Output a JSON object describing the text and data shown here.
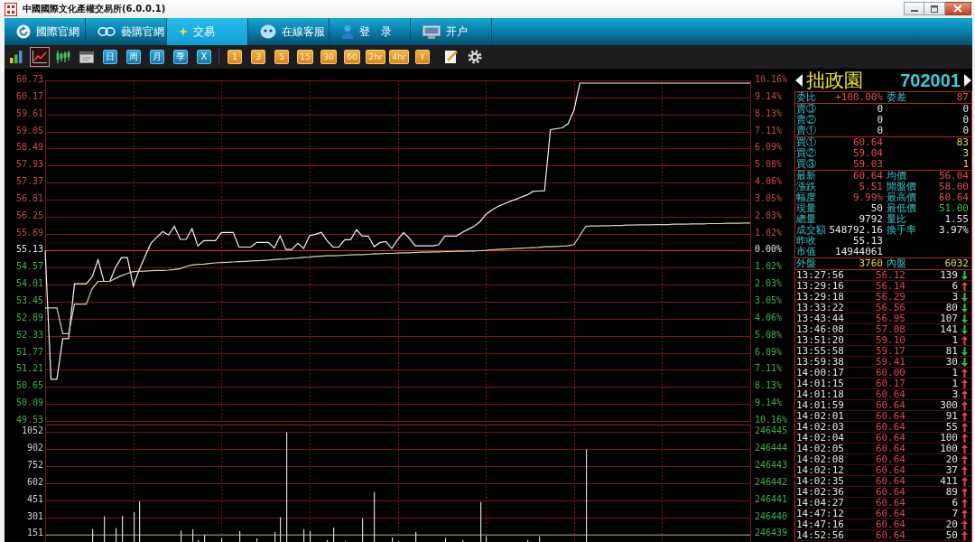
{
  "window": {
    "title": "中國國際文化產權交易所(6.0.0.1)"
  },
  "nav_tabs": [
    {
      "label": "國際官網",
      "selected": false
    },
    {
      "label": "藝購官網",
      "selected": false
    },
    {
      "label": "交易",
      "selected": true
    },
    {
      "label": "在線客服",
      "selected": false
    },
    {
      "label": "登　录",
      "selected": false
    },
    {
      "label": "开户",
      "selected": false
    }
  ],
  "toolbar": {
    "chart_modes": [
      {
        "selected": false
      },
      {
        "selected": true
      },
      {
        "selected": false
      },
      {
        "selected": false
      }
    ],
    "periods": [
      {
        "label": "日"
      },
      {
        "label": "周"
      },
      {
        "label": "月"
      },
      {
        "label": "季"
      },
      {
        "label": "X"
      }
    ],
    "intervals": [
      {
        "label": "1"
      },
      {
        "label": "3"
      },
      {
        "label": "5"
      },
      {
        "label": "15"
      },
      {
        "label": "30"
      },
      {
        "label": "60"
      },
      {
        "label": "2hr"
      },
      {
        "label": "4hr"
      },
      {
        "label": "Y"
      }
    ]
  },
  "price_chart": {
    "chart_data": {
      "type": "line",
      "grid": true,
      "ylim": [
        49.53,
        60.73
      ],
      "yticks": [
        {
          "value": 60.73,
          "label": "60.73"
        },
        {
          "value": 60.17,
          "label": "60.17"
        },
        {
          "value": 59.61,
          "label": "59.61"
        },
        {
          "value": 59.05,
          "label": "59.05"
        },
        {
          "value": 58.49,
          "label": "58.49"
        },
        {
          "value": 57.93,
          "label": "57.93"
        },
        {
          "value": 57.37,
          "label": "57.37"
        },
        {
          "value": 56.81,
          "label": "56.81"
        },
        {
          "value": 56.25,
          "label": "56.25"
        },
        {
          "value": 55.69,
          "label": "55.69"
        },
        {
          "value": 55.13,
          "label": "55.13"
        },
        {
          "value": 54.57,
          "label": "54.57"
        },
        {
          "value": 54.01,
          "label": "54.01"
        },
        {
          "value": 53.45,
          "label": "53.45"
        },
        {
          "value": 52.89,
          "label": "52.89"
        },
        {
          "value": 52.33,
          "label": "52.33"
        },
        {
          "value": 51.77,
          "label": "51.77"
        },
        {
          "value": 51.21,
          "label": "51.21"
        },
        {
          "value": 50.65,
          "label": "50.65"
        },
        {
          "value": 50.09,
          "label": "50.09"
        },
        {
          "value": 49.53,
          "label": "49.53"
        }
      ],
      "ref_lines": [
        {
          "axis": "y",
          "value": 55.13,
          "color": "#e03030"
        }
      ],
      "categories": [
        null,
        null,
        null,
        null,
        null,
        null,
        null,
        null,
        null,
        null,
        null,
        null,
        null,
        null,
        null,
        null,
        null,
        null,
        null,
        null,
        null,
        null,
        null,
        null,
        null,
        null,
        null,
        null,
        null,
        null,
        null,
        null,
        null,
        null,
        null,
        null,
        null,
        null,
        null,
        null,
        null,
        null,
        null,
        null,
        null,
        null,
        null,
        null,
        null,
        null,
        null,
        null,
        null,
        null,
        null,
        null,
        null,
        null,
        null,
        null,
        null,
        null,
        null,
        null,
        null,
        null,
        null,
        null,
        null,
        null,
        null,
        null,
        null,
        null,
        null,
        null,
        null,
        null,
        null,
        null,
        null,
        null,
        null,
        null,
        null,
        null,
        null,
        null,
        null,
        null,
        null,
        null,
        null,
        null,
        null,
        null,
        null,
        null,
        null,
        null,
        null,
        null,
        null,
        null,
        null,
        null,
        null,
        null,
        null,
        null,
        null,
        null,
        null,
        null,
        null,
        null,
        null,
        null,
        null,
        null,
        null
      ],
      "series": [
        {
          "color": "#f4f4f4",
          "values": [
            55.13,
            50.9,
            50.9,
            52.24,
            52.24,
            54.04,
            54.04,
            54.04,
            54.27,
            54.83,
            54.12,
            54.12,
            54.59,
            54.9,
            54.9,
            53.97,
            54.5,
            54.94,
            55.37,
            55.57,
            55.76,
            55.64,
            55.93,
            55.5,
            55.5,
            55.85,
            55.29,
            55.46,
            55.46,
            55.46,
            55.73,
            55.73,
            55.73,
            55.25,
            55.25,
            55.25,
            55.4,
            55.4,
            55.4,
            55.22,
            55.61,
            55.17,
            55.17,
            55.37,
            55.2,
            55.62,
            55.67,
            55.73,
            55.45,
            55.25,
            55.25,
            55.49,
            55.49,
            55.82,
            55.61,
            55.61,
            55.26,
            55.4,
            55.43,
            55.2,
            55.49,
            55.73,
            55.53,
            55.29,
            55.29,
            55.29,
            55.29,
            55.33,
            55.61,
            55.61,
            55.61,
            55.73,
            55.83,
            55.93,
            56.08,
            56.32,
            56.46,
            56.58,
            56.66,
            56.74,
            56.81,
            56.89,
            56.96,
            57.08,
            57.09,
            57.1,
            59.11,
            59.14,
            59.17,
            59.3,
            59.75,
            60.64,
            60.64,
            60.64,
            60.64,
            60.64,
            60.64,
            60.64,
            60.64,
            60.64,
            60.64,
            60.64,
            60.64,
            60.64,
            60.64,
            60.64,
            60.64,
            60.64,
            60.64,
            60.64,
            60.64,
            60.64,
            60.64,
            60.64,
            60.64,
            60.64,
            60.64,
            60.64,
            60.64,
            60.64,
            60.64
          ]
        },
        {
          "color": "#d6d6b4",
          "values": [
            53.25,
            53.25,
            53.25,
            52.4,
            52.4,
            53.37,
            53.37,
            53.37,
            53.88,
            54.12,
            54.12,
            54.12,
            54.22,
            54.31,
            54.38,
            54.44,
            54.45,
            54.46,
            54.47,
            54.48,
            54.48,
            54.49,
            54.51,
            54.54,
            54.61,
            54.66,
            54.68,
            54.69,
            54.71,
            54.73,
            54.74,
            54.75,
            54.76,
            54.77,
            54.78,
            54.79,
            54.8,
            54.81,
            54.82,
            54.84,
            54.85,
            54.86,
            54.88,
            54.89,
            54.91,
            54.92,
            54.94,
            54.95,
            54.96,
            54.96,
            54.97,
            54.98,
            54.99,
            55.0,
            55.0,
            55.01,
            55.02,
            55.03,
            55.04,
            55.04,
            55.05,
            55.06,
            55.06,
            55.07,
            55.08,
            55.08,
            55.09,
            55.09,
            55.1,
            55.1,
            55.11,
            55.11,
            55.12,
            55.12,
            55.13,
            55.14,
            55.16,
            55.17,
            55.18,
            55.19,
            55.2,
            55.21,
            55.22,
            55.23,
            55.24,
            55.26,
            55.26,
            55.27,
            55.28,
            55.29,
            55.33,
            55.63,
            55.93,
            55.94,
            55.94,
            55.95,
            55.95,
            55.96,
            55.96,
            55.97,
            55.97,
            55.98,
            55.98,
            55.98,
            55.99,
            55.99,
            55.99,
            56.0,
            56.0,
            56.0,
            56.01,
            56.01,
            56.01,
            56.02,
            56.02,
            56.02,
            56.03,
            56.03,
            56.03,
            56.04,
            56.04
          ]
        }
      ]
    },
    "right_axis_labels": [
      "10.16%",
      "9.14%",
      "8.13%",
      "7.11%",
      "6.09%",
      "5.08%",
      "4.06%",
      "3.05%",
      "2.03%",
      "1.02%",
      "0.00%",
      "1.02%",
      "2.03%",
      "3.05%",
      "4.06%",
      "5.08%",
      "6.09%",
      "7.11%",
      "8.13%",
      "9.14%",
      "10.16%"
    ]
  },
  "volume_chart": {
    "chart_data": {
      "type": "bar",
      "grid": true,
      "ylim": [
        83,
        1052
      ],
      "yticks": [
        {
          "value": 1052,
          "label": "1052"
        },
        {
          "value": 902,
          "label": "902"
        },
        {
          "value": 752,
          "label": "752"
        },
        {
          "value": 602,
          "label": "602"
        },
        {
          "value": 451,
          "label": "451"
        },
        {
          "value": 301,
          "label": "301"
        },
        {
          "value": 151,
          "label": "151"
        }
      ],
      "ref_lines": [
        {
          "axis": "y",
          "value": 147,
          "color": "#2ea84a"
        }
      ],
      "categories": [
        null,
        null,
        null,
        null,
        null,
        null,
        null,
        null,
        null,
        null,
        null,
        null,
        null,
        null,
        null,
        null,
        null,
        null,
        null,
        null,
        null,
        null,
        null,
        null,
        null,
        null,
        null,
        null,
        null,
        null,
        null,
        null,
        null,
        null,
        null,
        null,
        null,
        null,
        null,
        null,
        null,
        null,
        null,
        null,
        null,
        null,
        null,
        null,
        null,
        null,
        null,
        null,
        null,
        null,
        null,
        null,
        null,
        null,
        null,
        null,
        null,
        null,
        null,
        null,
        null,
        null,
        null,
        null,
        null,
        null,
        null,
        null,
        null,
        null,
        null,
        null,
        null,
        null,
        null,
        null,
        null,
        null,
        null,
        null,
        null,
        null,
        null,
        null,
        null,
        null,
        null,
        null,
        null,
        null,
        null,
        null,
        null,
        null,
        null,
        null,
        null,
        null,
        null,
        null,
        null,
        null,
        null,
        null,
        null,
        null,
        null,
        null,
        null,
        null,
        null,
        null,
        null,
        null,
        null,
        null,
        null
      ],
      "values": [
        null,
        null,
        null,
        null,
        null,
        null,
        null,
        null,
        196,
        null,
        309,
        null,
        205,
        313,
        null,
        345,
        440,
        null,
        null,
        null,
        null,
        null,
        null,
        186,
        null,
        196,
        100,
        146,
        null,
        null,
        115,
        null,
        null,
        178,
        null,
        null,
        115,
        null,
        null,
        170,
        301,
        1050,
        null,
        null,
        196,
        178,
        null,
        null,
        100,
        210,
        null,
        90,
        null,
        null,
        292,
        null,
        523,
        null,
        null,
        125,
        90,
        null,
        null,
        170,
        null,
        null,
        null,
        null,
        120,
        null,
        null,
        100,
        null,
        null,
        435,
        134,
        null,
        null,
        null,
        null,
        null,
        null,
        100,
        null,
        134,
        null,
        null,
        null,
        null,
        null,
        null,
        null,
        899,
        null,
        null,
        null,
        null,
        null,
        null,
        null,
        null,
        null,
        null,
        null,
        null,
        null,
        null,
        null,
        null,
        null,
        null,
        null,
        null,
        null,
        null,
        null,
        null,
        null,
        null,
        null,
        null
      ]
    },
    "right_axis_labels": [
      "246445",
      "246444",
      "246443",
      "246442",
      "246441",
      "246440",
      "246439"
    ]
  },
  "quote": {
    "name": "拙政園",
    "code": "702001",
    "ratio": [
      {
        "label": "委比",
        "value": "+100.00%",
        "color": "#e05050"
      },
      {
        "label": "委差",
        "value": "87",
        "color": "#d05a4a"
      }
    ],
    "asks": [
      {
        "label": "賣③",
        "price": "0",
        "volume": "0"
      },
      {
        "label": "賣②",
        "price": "0",
        "volume": "0"
      },
      {
        "label": "賣①",
        "price": "0",
        "volume": "0"
      }
    ],
    "bids": [
      {
        "label": "買①",
        "price": "60.64",
        "volume": "83"
      },
      {
        "label": "買②",
        "price": "59.04",
        "volume": "3"
      },
      {
        "label": "買③",
        "price": "59.03",
        "volume": "1"
      }
    ],
    "stats": [
      {
        "cells": [
          {
            "label": "最新",
            "value": "60.64",
            "color": "#e05050"
          },
          {
            "label": "均價",
            "value": "56.04",
            "color": "#e05050"
          }
        ]
      },
      {
        "cells": [
          {
            "label": "漲跌",
            "value": "5.51",
            "color": "#e05050"
          },
          {
            "label": "開盤價",
            "value": "58.00",
            "color": "#e05050"
          }
        ]
      },
      {
        "cells": [
          {
            "label": "幅度",
            "value": "9.99%",
            "color": "#e05050"
          },
          {
            "label": "最高價",
            "value": "60.64",
            "color": "#e05050"
          }
        ]
      },
      {
        "cells": [
          {
            "label": "現量",
            "value": "50",
            "color": "#e8e8e8"
          },
          {
            "label": "最低價",
            "value": "51.00",
            "color": "#40c040"
          }
        ]
      },
      {
        "cells": [
          {
            "label": "總量",
            "value": "9792",
            "color": "#e8e8e8"
          },
          {
            "label": "量比",
            "value": "1.55",
            "color": "#e8e8e8"
          }
        ]
      },
      {
        "cells": [
          {
            "label": "成交額",
            "value": "548792.16",
            "color": "#e8e8e8"
          },
          {
            "label": "換手率",
            "value": "3.97%",
            "color": "#e8e8e8"
          }
        ]
      },
      {
        "cells": [
          {
            "label": "昨收",
            "value": "55.13",
            "color": "#e8e8e8"
          }
        ]
      },
      {
        "cells": [
          {
            "label": "市值",
            "value": "14944061",
            "color": "#e8e8e8"
          }
        ]
      }
    ],
    "flow": [
      {
        "label": "外盤",
        "value": "3760"
      },
      {
        "label": "內盤",
        "value": "6032"
      }
    ],
    "trades": [
      {
        "time": "13:27:56",
        "price": "56.12",
        "volume": "139",
        "up": false
      },
      {
        "time": "13:29:16",
        "price": "56.14",
        "volume": "6",
        "up": true
      },
      {
        "time": "13:29:18",
        "price": "56.29",
        "volume": "3",
        "up": false
      },
      {
        "time": "13:33:22",
        "price": "56.56",
        "volume": "80",
        "up": false
      },
      {
        "time": "13:43:44",
        "price": "56.95",
        "volume": "107",
        "up": false
      },
      {
        "time": "13:46:08",
        "price": "57.08",
        "volume": "141",
        "up": false
      },
      {
        "time": "13:51:20",
        "price": "59.10",
        "volume": "1",
        "up": true
      },
      {
        "time": "13:55:58",
        "price": "59.17",
        "volume": "81",
        "up": false
      },
      {
        "time": "13:59:38",
        "price": "59.41",
        "volume": "30",
        "up": false
      },
      {
        "time": "14:00:17",
        "price": "60.00",
        "volume": "1",
        "up": true
      },
      {
        "time": "14:01:15",
        "price": "60.17",
        "volume": "1",
        "up": true
      },
      {
        "time": "14:01:18",
        "price": "60.64",
        "volume": "3",
        "up": true
      },
      {
        "time": "14:01:59",
        "price": "60.64",
        "volume": "300",
        "up": true
      },
      {
        "time": "14:02:01",
        "price": "60.64",
        "volume": "91",
        "up": true
      },
      {
        "time": "14:02:03",
        "price": "60.64",
        "volume": "55",
        "up": true
      },
      {
        "time": "14:02:04",
        "price": "60.64",
        "volume": "100",
        "up": true
      },
      {
        "time": "14:02:05",
        "price": "60.64",
        "volume": "100",
        "up": true
      },
      {
        "time": "14:02:08",
        "price": "60.64",
        "volume": "20",
        "up": true
      },
      {
        "time": "14:02:12",
        "price": "60.64",
        "volume": "37",
        "up": true
      },
      {
        "time": "14:02:35",
        "price": "60.64",
        "volume": "411",
        "up": true
      },
      {
        "time": "14:02:36",
        "price": "60.64",
        "volume": "89",
        "up": true
      },
      {
        "time": "14:04:27",
        "price": "60.64",
        "volume": "6",
        "up": true
      },
      {
        "time": "14:47:12",
        "price": "60.64",
        "volume": "7",
        "up": true
      },
      {
        "time": "14:47:16",
        "price": "60.64",
        "volume": "20",
        "up": true
      },
      {
        "time": "14:52:56",
        "price": "60.64",
        "volume": "50",
        "up": true
      }
    ]
  }
}
